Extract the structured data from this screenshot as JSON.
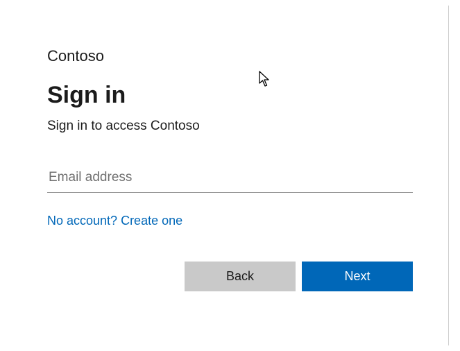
{
  "brand": "Contoso",
  "heading": "Sign in",
  "subtitle": "Sign in to access Contoso",
  "email": {
    "placeholder": "Email address",
    "value": ""
  },
  "createLink": "No account? Create one",
  "buttons": {
    "back": "Back",
    "next": "Next"
  },
  "colors": {
    "accent": "#0067B8",
    "secondaryButton": "#c9c9c9"
  }
}
